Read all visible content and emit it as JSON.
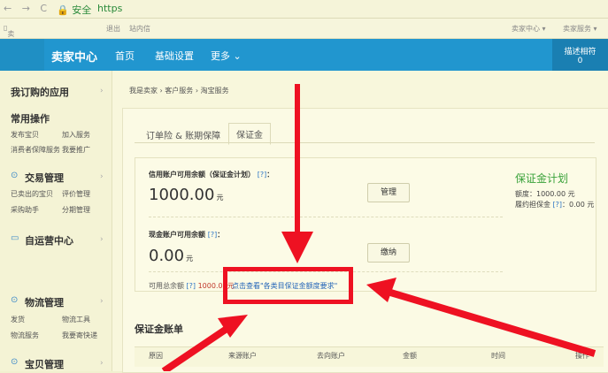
{
  "browser": {
    "nav": "← → C",
    "secure": "安全",
    "url": "https"
  },
  "topbar": {
    "mobile": "卖家手机端",
    "logout": "退出",
    "sitemsg": "站内信",
    "seller_center": "卖家中心 ▾",
    "seller_service": "卖家服务 ▾"
  },
  "header": {
    "brand": "卖家中心",
    "nav": [
      "首页",
      "基础设置",
      "更多 ⌄"
    ],
    "account_label": "描述相符",
    "account_value": "0"
  },
  "sidebar": {
    "my_apps": "我订购的应用",
    "common_ops": "常用操作",
    "common_links": [
      "发布宝贝",
      "加入服务",
      "消费者保障服务",
      "我要推广"
    ],
    "trade_mgmt": "交易管理",
    "trade_links": [
      "已卖出的宝贝",
      "评价管理",
      "采购助手",
      "分期管理"
    ],
    "self_center": "自运营中心",
    "logistics": "物流管理",
    "logistics_links": [
      "发货",
      "物流工具",
      "物流服务",
      "我要寄快递"
    ],
    "items_mgmt": "宝贝管理"
  },
  "breadcrumb": [
    "我是卖家",
    "客户服务",
    "淘宝服务"
  ],
  "tabs": [
    "订单险 & 账期保障",
    "保证金"
  ],
  "credit": {
    "label": "信用账户可用余额（保证金计划）",
    "help": "[?]",
    "colon": "：",
    "amount": "1000.00",
    "unit": "元",
    "button": "管理"
  },
  "plan": {
    "logo": "保证金计划",
    "quota_label": "额度：",
    "quota": "1000.00 元",
    "deposit_label": "履约担保金",
    "deposit_help": "[?]",
    "deposit": "：0.00 元"
  },
  "cash": {
    "label": "现金账户可用余额",
    "help": "[?]",
    "colon": "：",
    "amount": "0.00",
    "unit": "元",
    "button": "缴纳"
  },
  "total": {
    "label": "可用总余额",
    "help": "[?]",
    "amount": "1000.00",
    "unit": "元",
    "link": "点击查看\"各类目保证金额度要求\""
  },
  "ledger": {
    "title": "保证金账单",
    "columns": [
      "原因",
      "来源账户",
      "去向账户",
      "金额",
      "时间",
      "操作"
    ]
  },
  "colors": {
    "header": "#2196cf",
    "highlight": "#ee1122",
    "link": "#2364b8"
  }
}
